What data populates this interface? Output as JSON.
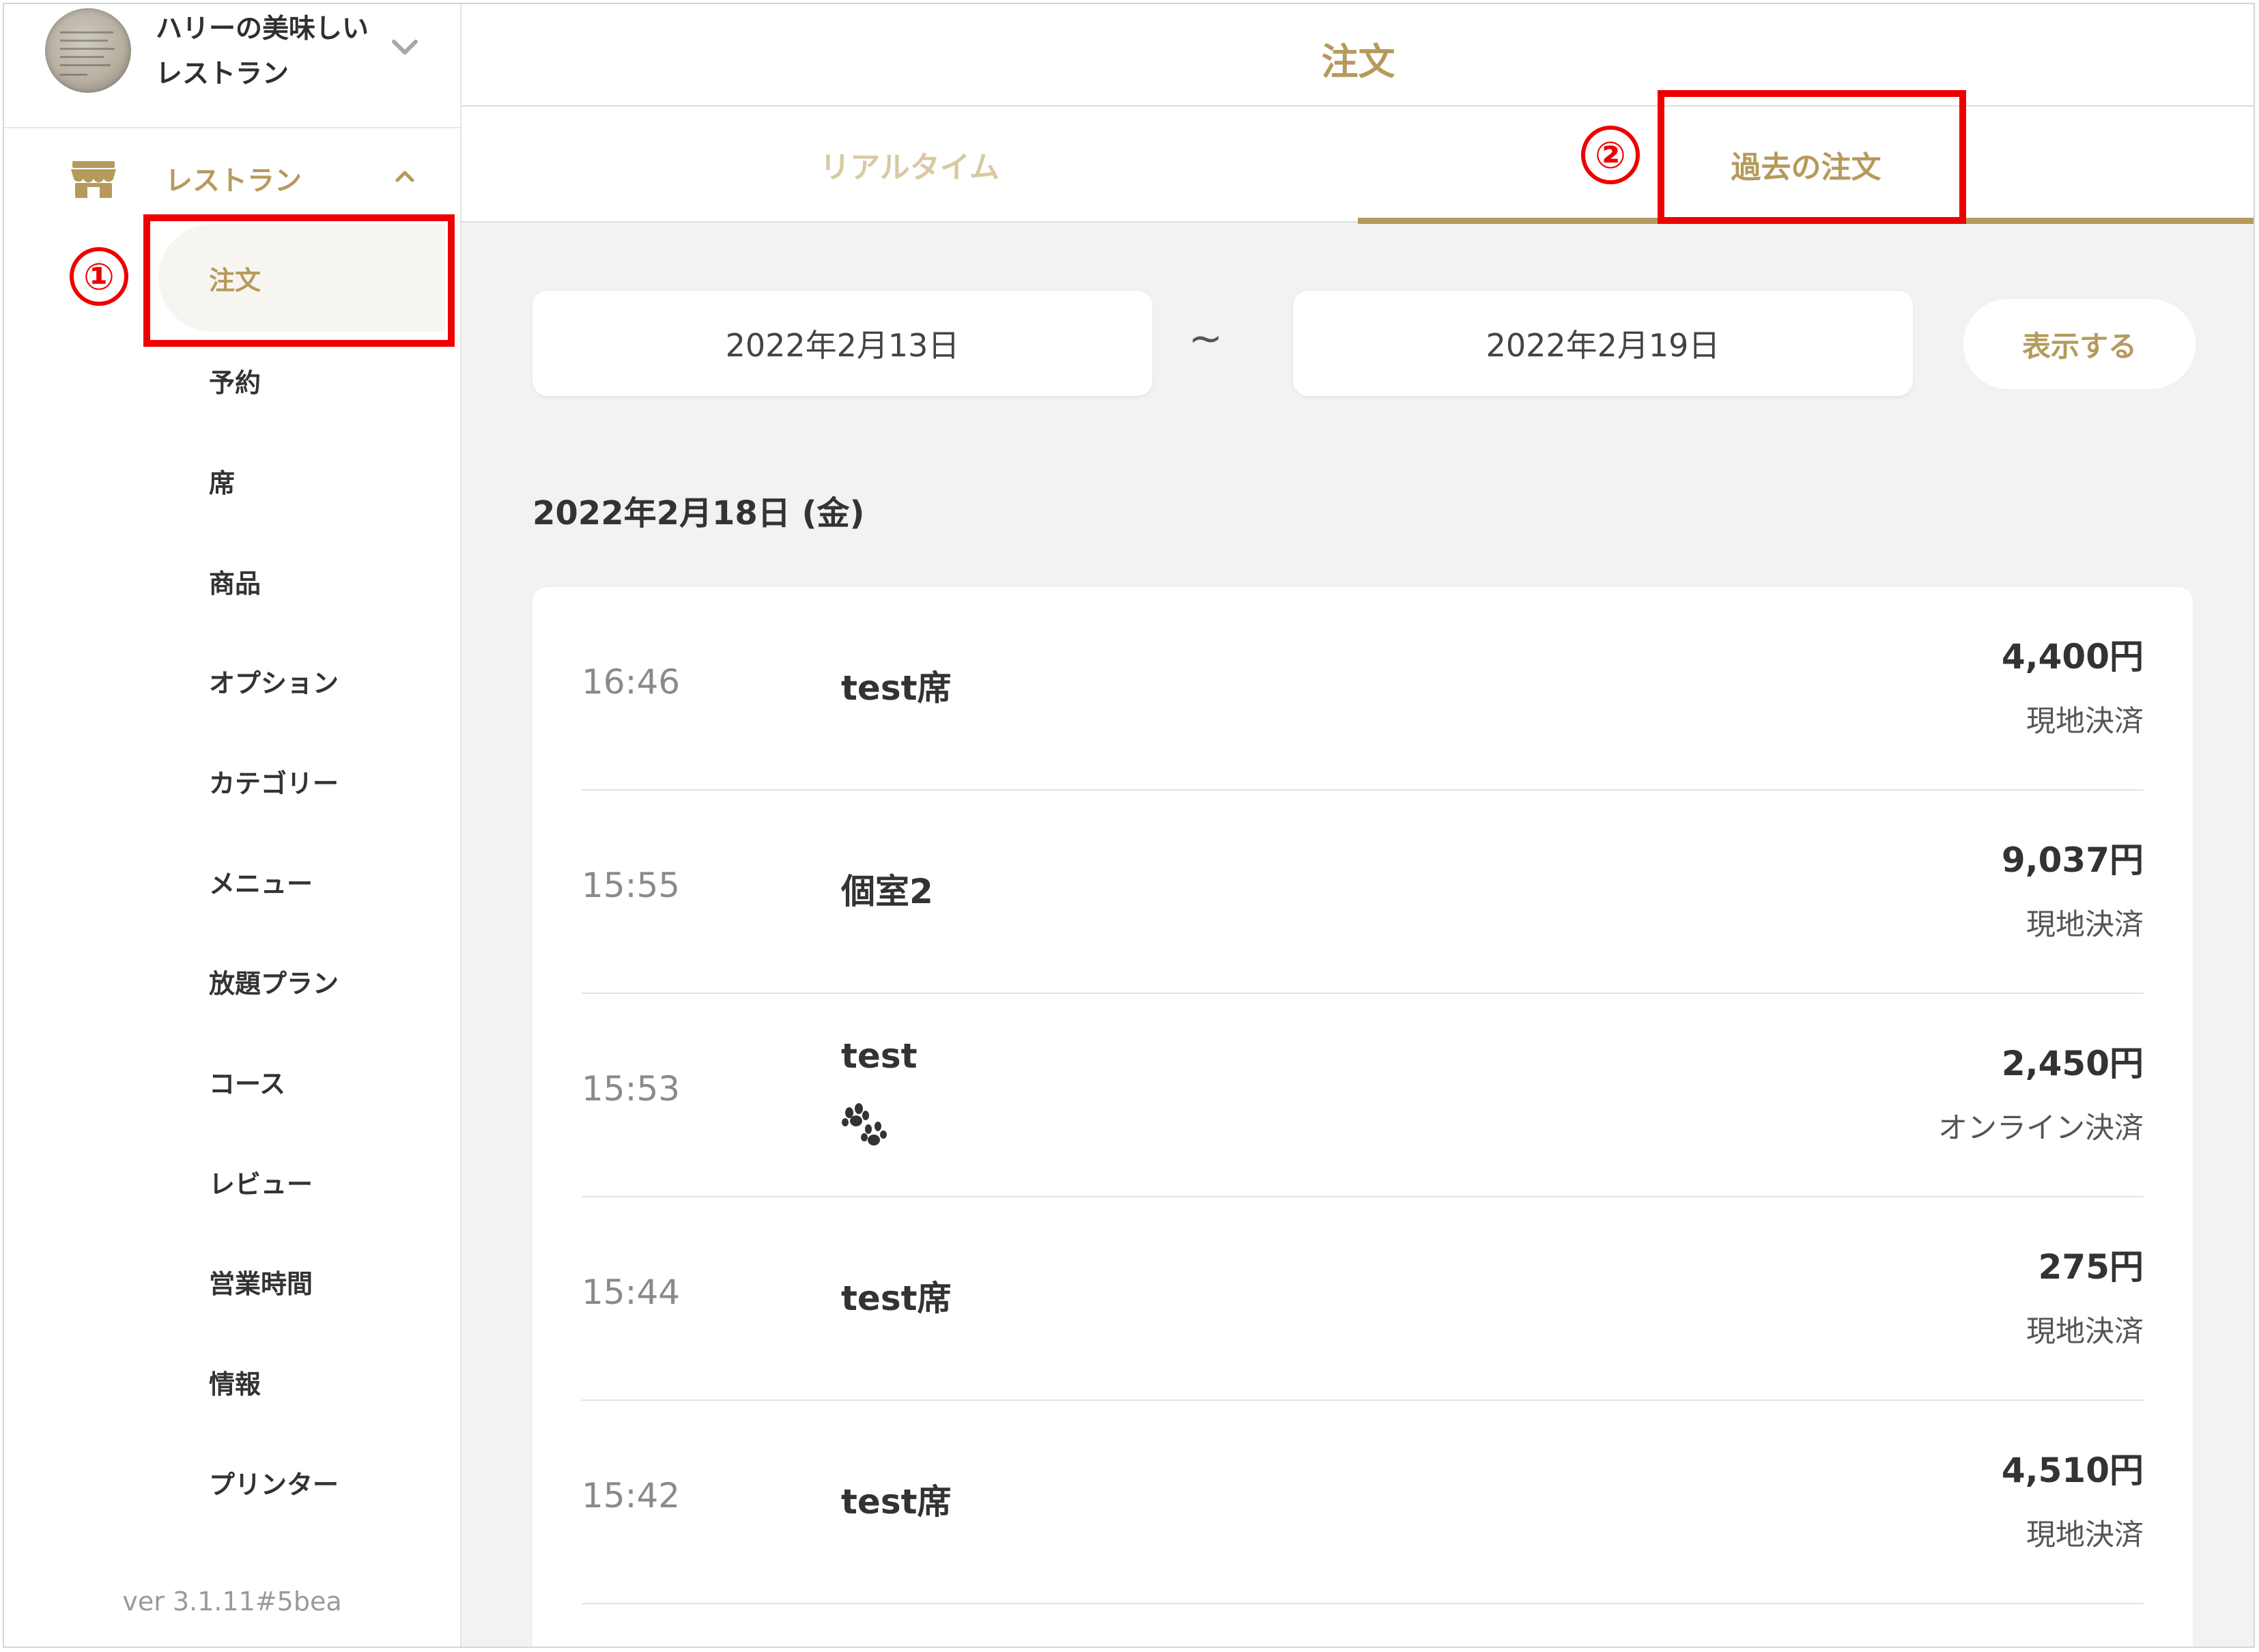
{
  "store": {
    "name_line1": "ハリーの美味しい",
    "name_line2": "レストラン"
  },
  "sidebar": {
    "section_label": "レストラン",
    "items": [
      {
        "label": "注文",
        "active": true
      },
      {
        "label": "予約"
      },
      {
        "label": "席"
      },
      {
        "label": "商品"
      },
      {
        "label": "オプション"
      },
      {
        "label": "カテゴリー"
      },
      {
        "label": "メニュー"
      },
      {
        "label": "放題プラン"
      },
      {
        "label": "コース"
      },
      {
        "label": "レビュー"
      },
      {
        "label": "営業時間"
      },
      {
        "label": "情報"
      },
      {
        "label": "プリンター"
      }
    ],
    "version": "ver 3.1.11#5bea"
  },
  "header": {
    "title": "注文"
  },
  "tabs": [
    {
      "label": "リアルタイム",
      "active": false
    },
    {
      "label": "過去の注文",
      "active": true
    }
  ],
  "filter": {
    "date_from": "2022年2月13日",
    "separator": "~",
    "date_to": "2022年2月19日",
    "show_button": "表示する"
  },
  "day_heading": "2022年2月18日 (金)",
  "orders": [
    {
      "time": "16:46",
      "seat": "test席",
      "price": "4,400円",
      "payment": "現地決済"
    },
    {
      "time": "15:55",
      "seat": "個室2",
      "price": "9,037円",
      "payment": "現地決済"
    },
    {
      "time": "15:53",
      "seat": "test",
      "price": "2,450円",
      "payment": "オンライン決済",
      "icon": "paw-icon"
    },
    {
      "time": "15:44",
      "seat": "test席",
      "price": "275円",
      "payment": "現地決済"
    },
    {
      "time": "15:42",
      "seat": "test席",
      "price": "4,510円",
      "payment": "現地決済"
    }
  ],
  "annotations": {
    "step1": "①",
    "step2": "②"
  },
  "colors": {
    "accent": "#b59a5c",
    "annotation": "#ee0000",
    "background": "#f2f2f2"
  }
}
